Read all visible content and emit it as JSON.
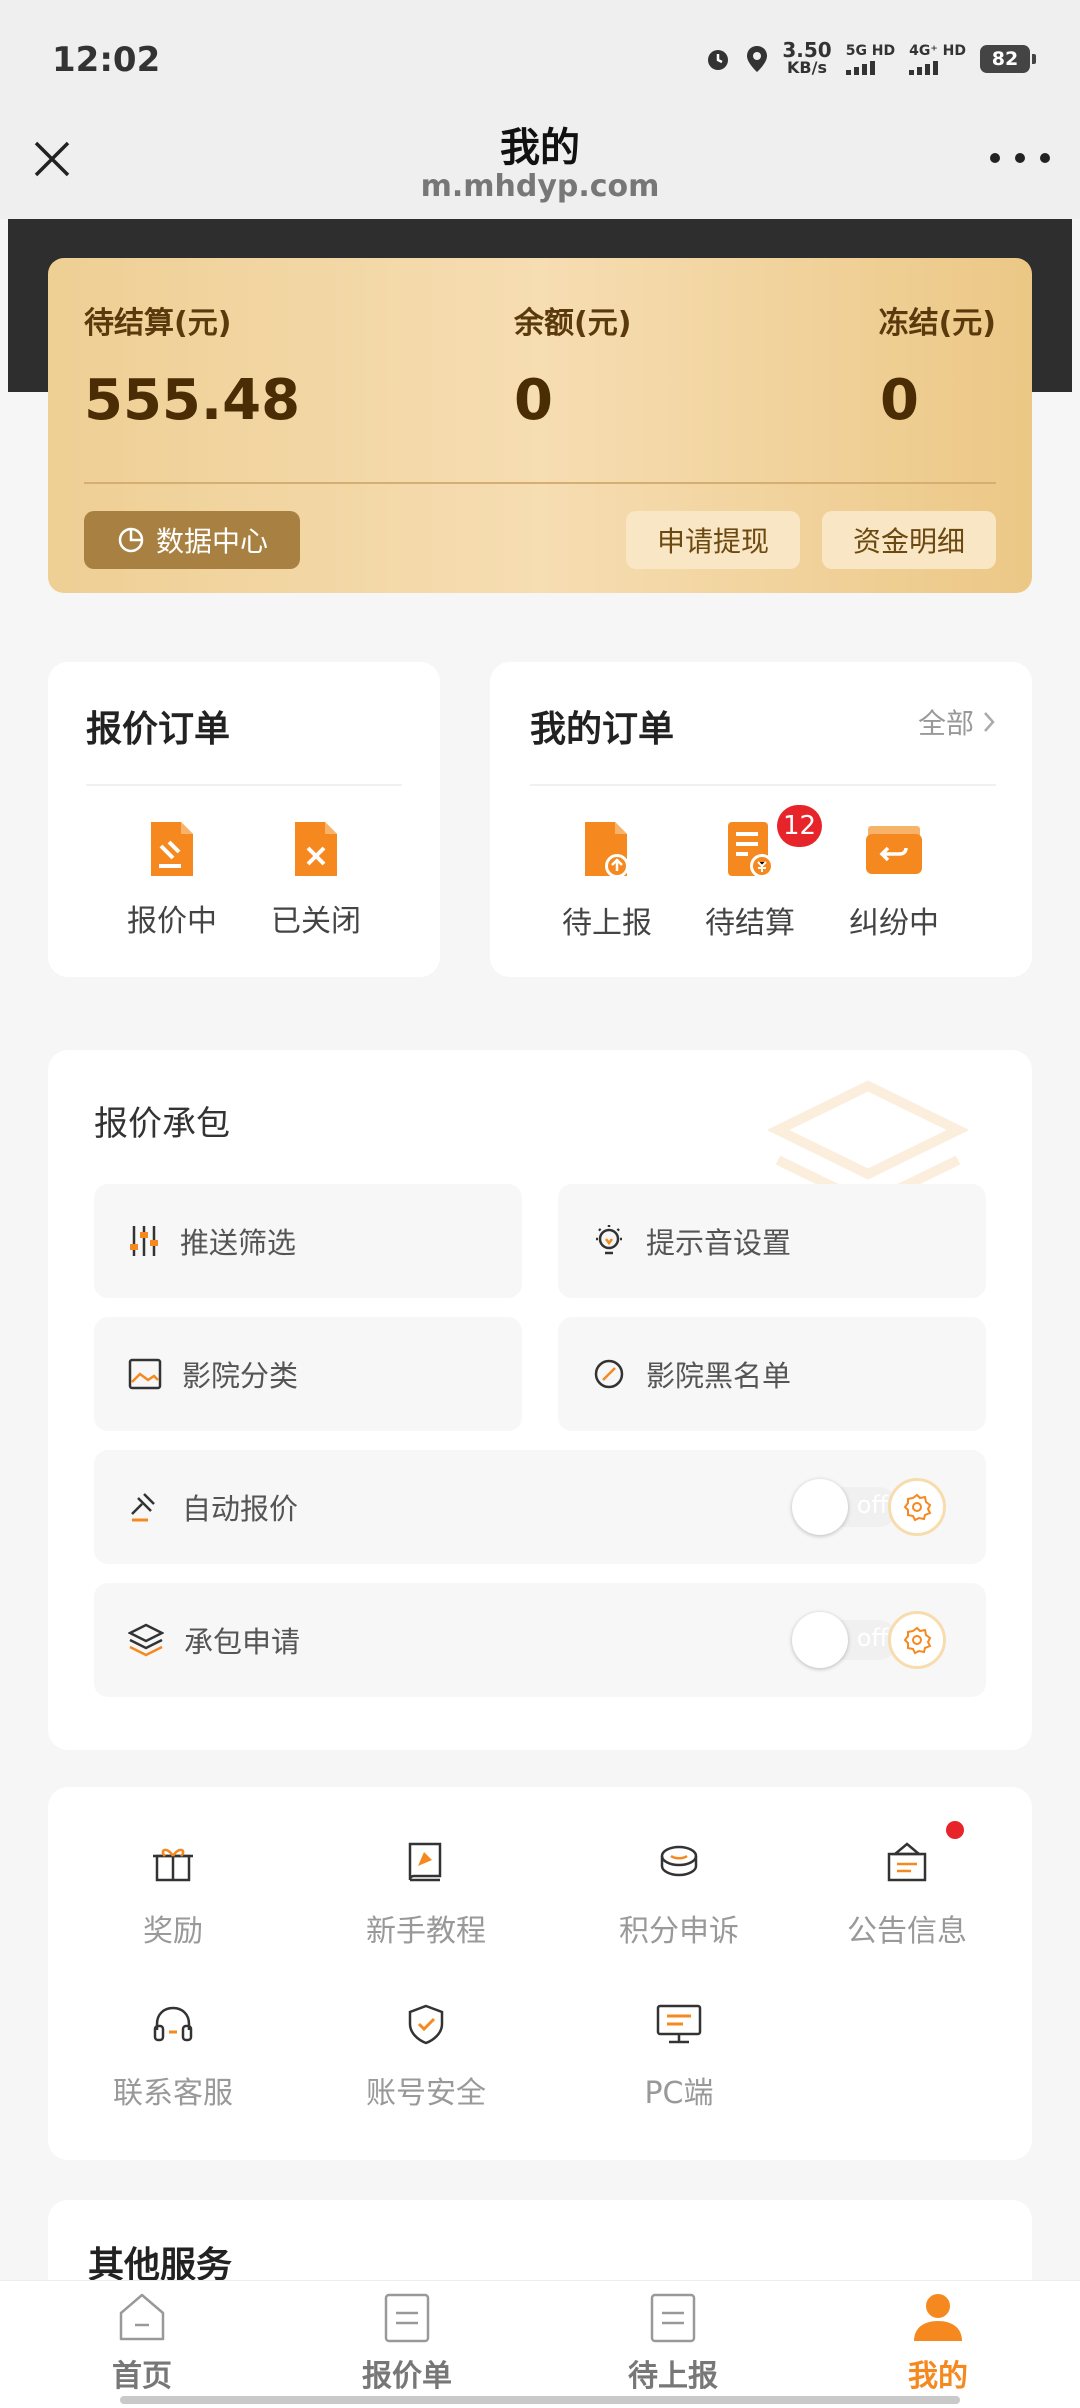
{
  "status_bar": {
    "time": "12:02",
    "net_speed": "3.50",
    "net_unit": "KB/s",
    "sig1": "5G HD",
    "sig2": "4G⁺ HD",
    "battery": "82"
  },
  "header": {
    "title": "我的",
    "url": "m.mhdyp.com"
  },
  "balance": {
    "pending_label": "待结算(元)",
    "pending_value": "555.48",
    "balance_label": "余额(元)",
    "balance_value": "0",
    "frozen_label": "冻结(元)",
    "frozen_value": "0",
    "data_center": "数据中心",
    "withdraw": "申请提现",
    "details": "资金明细"
  },
  "quote_orders": {
    "title": "报价订单",
    "items": [
      {
        "label": "报价中"
      },
      {
        "label": "已关闭"
      }
    ]
  },
  "my_orders": {
    "title": "我的订单",
    "view_all": "全部",
    "items": [
      {
        "label": "待上报"
      },
      {
        "label": "待结算",
        "badge": "12"
      },
      {
        "label": "纠纷中"
      }
    ]
  },
  "contract": {
    "title": "报价承包",
    "push_filter": "推送筛选",
    "sound_settings": "提示音设置",
    "cinema_category": "影院分类",
    "cinema_blacklist": "影院黑名单",
    "auto_quote": "自动报价",
    "auto_quote_state": "off",
    "contract_apply": "承包申请",
    "contract_apply_state": "off"
  },
  "tools": {
    "items": [
      {
        "label": "奖励"
      },
      {
        "label": "新手教程"
      },
      {
        "label": "积分申诉"
      },
      {
        "label": "公告信息"
      },
      {
        "label": "联系客服"
      },
      {
        "label": "账号安全"
      },
      {
        "label": "PC端"
      }
    ]
  },
  "other_services": {
    "title": "其他服务"
  },
  "tabbar": {
    "items": [
      {
        "label": "首页"
      },
      {
        "label": "报价单"
      },
      {
        "label": "待上报"
      },
      {
        "label": "我的"
      }
    ]
  },
  "colors": {
    "accent": "#f5891f",
    "card_gold": "#f6ddb2",
    "badge_red": "#e8242b"
  }
}
